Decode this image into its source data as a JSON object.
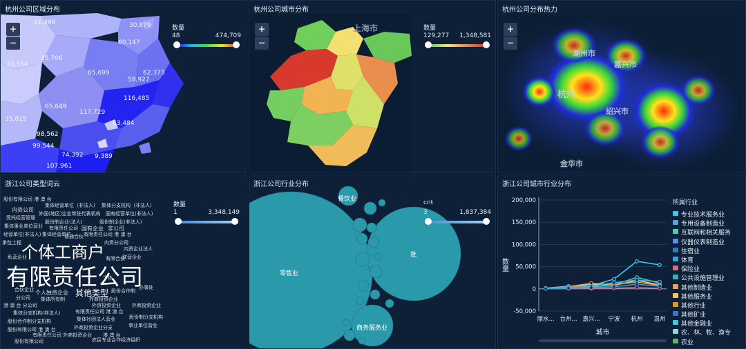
{
  "panels": {
    "district_map": {
      "title": "杭州公司区域分布",
      "zoom_in": "+",
      "zoom_out": "−",
      "visual_map": {
        "title": "数量",
        "min": "48",
        "max": "474,709"
      },
      "labels": [
        "11,496",
        "30,879",
        "60,147",
        "33,554",
        "25,706",
        "65,699",
        "62,373",
        "58,927",
        "65,649",
        "117,729",
        "116,485",
        "35,815",
        "63,484",
        "98,562",
        "99,544",
        "74,392",
        "9,389",
        "107,961"
      ]
    },
    "city_map": {
      "title": "杭州公司城市分布",
      "zoom_in": "+",
      "zoom_out": "−",
      "place_label": "上海市",
      "visual_map": {
        "title": "数量",
        "min": "129,277",
        "max": "1,348,581"
      }
    },
    "heat_map": {
      "title": "杭州公司分布热力",
      "zoom_in": "+",
      "zoom_out": "−",
      "place_labels": [
        "湖州市",
        "嘉兴市",
        "杭州",
        "绍兴市",
        "金华市"
      ]
    },
    "word_cloud": {
      "title": "浙江公司类型词云",
      "visual_map": {
        "title": "数量",
        "min": "1",
        "max": "3,348,149"
      },
      "words": [
        "股份有限公司 港 澳 台",
        "集体经营单位（非法人)",
        "集体分支机构（非法人）",
        "内资公司",
        "外国(地区)企业常驻代表机构",
        "国有经营单位(非法人)",
        "受托经营管理",
        "股份制企业(法人)",
        "股份制企业(非法人)",
        "集体事业单位营业",
        "有限责任公司",
        "国有企业",
        "非公司",
        "经营单位(非法人)",
        "集体经营单位",
        "有限责任公司 港 澳 台",
        "承包工程",
        "普通合伙",
        "内资分公司",
        "内资企业法人",
        "私营企业",
        "联营企业",
        "有限合伙",
        "个体工商户",
        "有限责任公司",
        "其他类型",
        "合伙企业",
        "个人独资企业",
        "股份合作制",
        "外商投资企业",
        "集体所有制",
        "个体",
        "分公司",
        "外资投资企业",
        "港 澳 台 分公司",
        "外商投资企业",
        "集体分支机构(非法人)",
        "有限责任公司 港 澳 台",
        "股份合作制分支机构",
        "集体社团法人营业",
        "股份制分支机构",
        "事业单位营业",
        "股份有限公司 港 澳 台",
        "外商投资企业分支",
        "有限责任公司 外商投资企业",
        "港 澳 台",
        "农民专业合作经济组织",
        "办事处",
        "股份有限公司"
      ]
    },
    "industry": {
      "title": "浙江公司行业分布",
      "visual_map": {
        "title": "cnt",
        "min": "3",
        "max": "1,837,384"
      },
      "bubble_labels": [
        "餐饮业",
        "零售业",
        "批",
        "商务服务业"
      ]
    },
    "city_industry": {
      "title": "浙江公司城市行业分布",
      "legend_title": "所属行业",
      "legend": [
        {
          "name": "专业技术服务业",
          "color": "#3ec7f0"
        },
        {
          "name": "专用设备制造业",
          "color": "#4fa7e8"
        },
        {
          "name": "互联网和相关服务",
          "color": "#3fd0b7"
        },
        {
          "name": "仪器仪表制造业",
          "color": "#5b8dd8"
        },
        {
          "name": "住宿业",
          "color": "#2e7fb8"
        },
        {
          "name": "体育",
          "color": "#3d9fd6"
        },
        {
          "name": "保险业",
          "color": "#e06a86"
        },
        {
          "name": "公共设施管理业",
          "color": "#3ab0c0"
        },
        {
          "name": "其他制造业",
          "color": "#e9a15a"
        },
        {
          "name": "其他服务业",
          "color": "#f0c85a"
        },
        {
          "name": "其他行业",
          "color": "#d89a2a"
        },
        {
          "name": "其他矿业",
          "color": "#3a76c2"
        },
        {
          "name": "其他金融业",
          "color": "#45c7d8"
        },
        {
          "name": "农、林、牧、渔专",
          "color": "#8fd8e0"
        },
        {
          "name": "农业",
          "color": "#5cb85c"
        }
      ]
    }
  },
  "chart_data": {
    "type": "line",
    "ylabel": "数量",
    "xlabel": "城市",
    "ylim": [
      -50000,
      200000
    ],
    "yticks": [
      "200,000",
      "150,000",
      "100,000",
      "50,000",
      "0",
      "-50,000"
    ],
    "categories": [
      "丽水...",
      "台州...",
      "嘉兴...",
      "宁波",
      "杭州",
      "温州"
    ],
    "series": [
      {
        "name": "专业技术服务业",
        "color": "#3ec7f0",
        "values": [
          1500,
          6000,
          7000,
          22000,
          62000,
          54000
        ]
      },
      {
        "name": "其他服务业",
        "color": "#f0c85a",
        "values": [
          800,
          4000,
          11000,
          8000,
          19000,
          9000
        ]
      },
      {
        "name": "互联网和相关服务",
        "color": "#3fd0b7",
        "values": [
          600,
          3000,
          4500,
          9000,
          26000,
          13000
        ]
      },
      {
        "name": "其他制造业",
        "color": "#e9a15a",
        "values": [
          1000,
          5000,
          12500,
          10000,
          15000,
          8000
        ]
      },
      {
        "name": "专用设备制造业",
        "color": "#4fa7e8",
        "values": [
          500,
          4000,
          6000,
          14000,
          20000,
          16000
        ]
      },
      {
        "name": "保险业",
        "color": "#e06a86",
        "values": [
          200,
          600,
          800,
          1500,
          3000,
          1200
        ]
      },
      {
        "name": "体育",
        "color": "#3d9fd6",
        "values": [
          300,
          1500,
          2500,
          5000,
          10000,
          6000
        ]
      }
    ]
  }
}
